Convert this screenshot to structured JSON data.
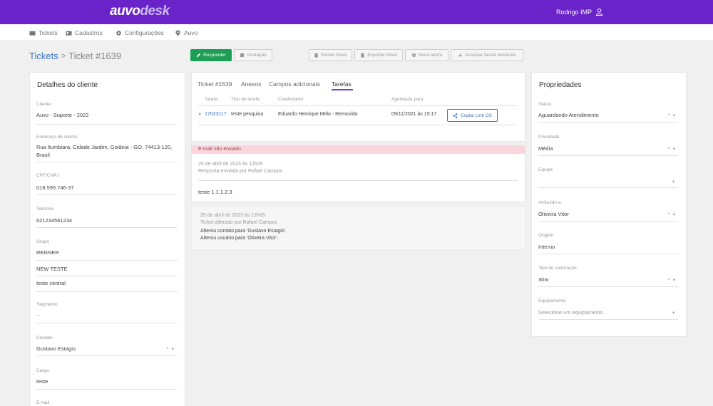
{
  "brand": {
    "logo_part1": "auvo",
    "logo_part2": "desk",
    "user_name": "Rodrigo IMP"
  },
  "nav": {
    "items": [
      {
        "label": "Tickets",
        "icon": "envelope-icon"
      },
      {
        "label": "Cadastros",
        "icon": "id-card-icon"
      },
      {
        "label": "Configurações",
        "icon": "gear-icon"
      },
      {
        "label": "Auvo",
        "icon": "map-pin-icon"
      }
    ]
  },
  "breadcrumb": {
    "root": "Tickets",
    "current": "Ticket #1639"
  },
  "toolbar": {
    "responder": "Responder",
    "anotacao": "Anotação",
    "excluir": "Excluir ticket",
    "exportar": "Exportar ticket",
    "nova_tarefa": "Nova tarefa",
    "associar": "Associar tarefa existente"
  },
  "client": {
    "title": "Detalhes do cliente",
    "cliente_label": "Cliente",
    "cliente_value": "Auvo - Suporte - 2022",
    "endereco_label": "Endereço do cliente",
    "endereco_value": "Rua Itumbiara, Cidade Jardim, Goiânia - GO, 74413-120, Brasil",
    "cpf_label": "CPF/CNPJ",
    "cpf_value": "018.595.746-37",
    "telefone_label": "Telefone",
    "telefone_value": "621234561234",
    "grupo_label": "Grupo",
    "grupo_values": [
      "RENNER",
      "NEW TESTE",
      "teste central"
    ],
    "segmento_label": "Segmento",
    "segmento_value": "--",
    "contato_label": "Contato",
    "contato_value": "Gustavo Estagio",
    "cargo_label": "Cargo",
    "cargo_value": "teste",
    "email_label": "E-mail"
  },
  "ticket": {
    "tabs": [
      "Ticket #1639",
      "Anexos",
      "Campos adicionais",
      "Tarefas"
    ],
    "active_tab": "Tarefas",
    "table": {
      "headers": [
        "Tarefa",
        "Tipo de tarefa",
        "Colaborador",
        "Agendada para"
      ],
      "rows": [
        {
          "tarefa": "17033117",
          "tipo": "teste pesquisa",
          "colaborador": "Eduardo Henrique Melo - Removido",
          "agendada": "09/11/2021 às 15:17",
          "action": "Copiar Link OS"
        }
      ]
    }
  },
  "email": {
    "status": "E-mail não enviado",
    "date": "25 de abril de 2023 às 12h05",
    "by": "Resposta enviada por Rafael Campos",
    "body": "teste 1.1.1.2.3"
  },
  "history": {
    "date": "25 de abril de 2023 às 12h05",
    "by": "Ticket alterado por Rafael Campos",
    "line1": "Alterou contato para 'Gustavo Estagio'.",
    "line2": "Alterou usuário para 'Oliveira Vitor'."
  },
  "props": {
    "title": "Propriedades",
    "status_label": "Status",
    "status_value": "Aguardando Atendimento",
    "prioridade_label": "Prioridade",
    "prioridade_value": "Média",
    "equipe_label": "Equipe",
    "equipe_value": "",
    "atribuido_label": "Atribuído a",
    "atribuido_value": "Oliveira Vitor",
    "origem_label": "Origem",
    "origem_value": "Interno",
    "tipo_label": "Tipo de solicitação",
    "tipo_value": "30m",
    "equipamento_label": "Equipamento",
    "equipamento_placeholder": "Selecione um equipamento"
  },
  "dropdown": {
    "clear": "×",
    "arrow": "▾"
  },
  "colors": {
    "brand": "#6a22c9",
    "primary": "#1e9e55",
    "link": "#3a73c7",
    "alert_bg": "#f9d6dc"
  }
}
